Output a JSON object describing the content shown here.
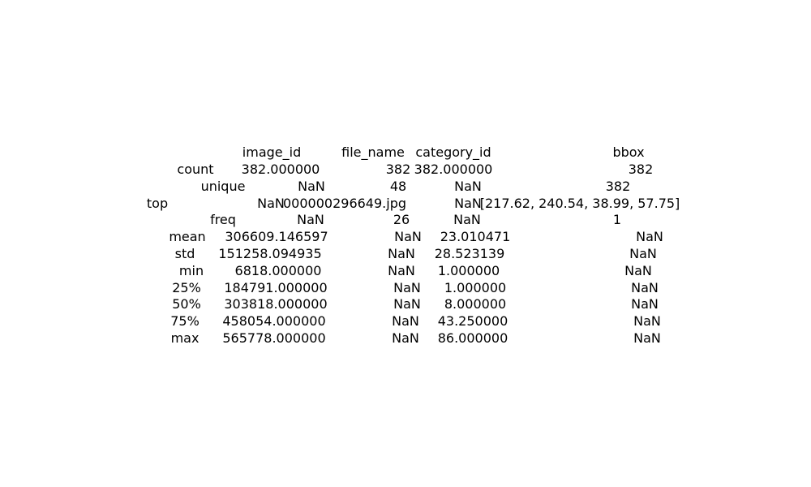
{
  "table": {
    "columns": [
      "image_id",
      "file_name",
      "category_id",
      "bbox"
    ],
    "rows": [
      {
        "label": "count",
        "cells": [
          "382.000000",
          "382",
          "382.000000",
          "382"
        ]
      },
      {
        "label": "unique",
        "cells": [
          "NaN",
          "48",
          "NaN",
          "382"
        ]
      },
      {
        "label": "top",
        "cells": [
          "NaN",
          "000000296649.jpg",
          "NaN",
          "[217.62, 240.54, 38.99, 57.75]"
        ]
      },
      {
        "label": "freq",
        "cells": [
          "NaN",
          "26",
          "NaN",
          "1"
        ]
      },
      {
        "label": "mean",
        "cells": [
          "306609.146597",
          "NaN",
          "23.010471",
          "NaN"
        ]
      },
      {
        "label": "std",
        "cells": [
          "151258.094935",
          "NaN",
          "28.523139",
          "NaN"
        ]
      },
      {
        "label": "min",
        "cells": [
          "6818.000000",
          "NaN",
          "1.000000",
          "NaN"
        ]
      },
      {
        "label": "25%",
        "cells": [
          "184791.000000",
          "NaN",
          "1.000000",
          "NaN"
        ]
      },
      {
        "label": "50%",
        "cells": [
          "303818.000000",
          "NaN",
          "8.000000",
          "NaN"
        ]
      },
      {
        "label": "75%",
        "cells": [
          "458054.000000",
          "NaN",
          "43.250000",
          "NaN"
        ]
      },
      {
        "label": "max",
        "cells": [
          "565778.000000",
          "NaN",
          "86.000000",
          "NaN"
        ]
      }
    ]
  }
}
